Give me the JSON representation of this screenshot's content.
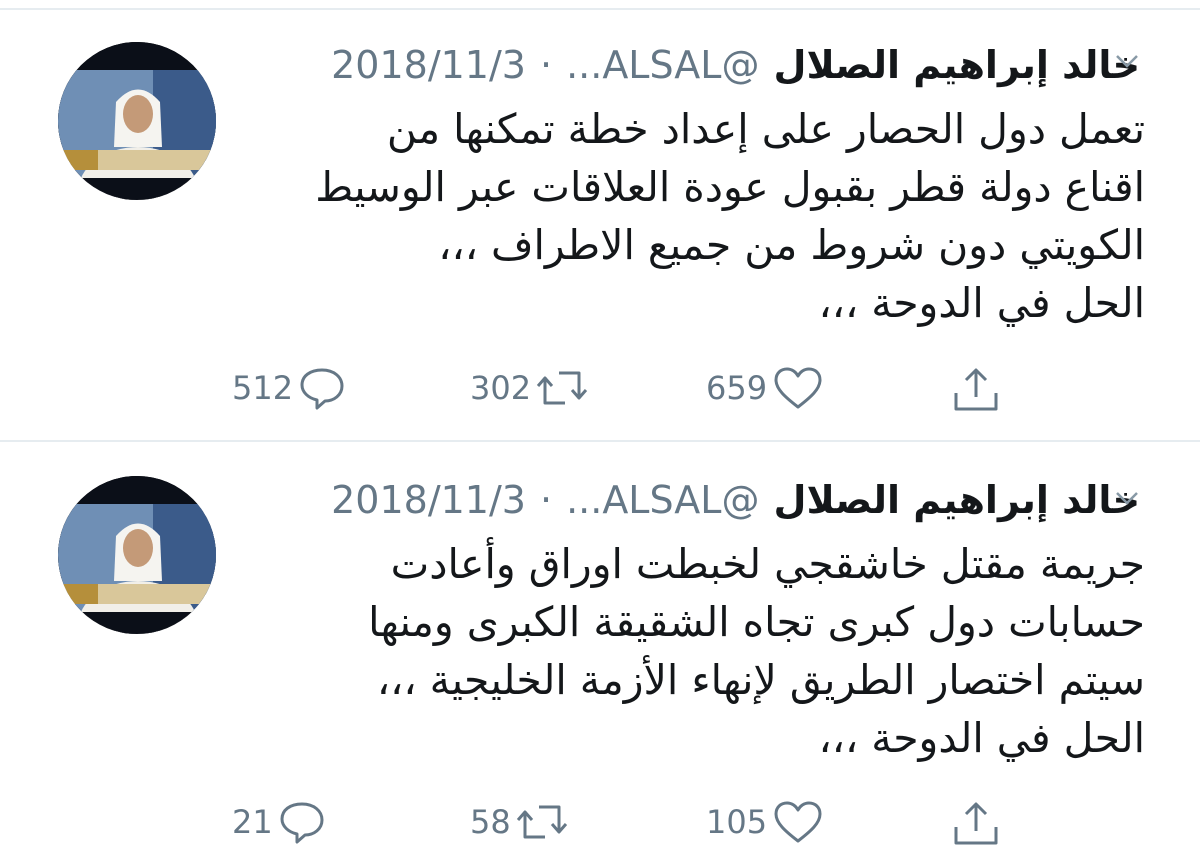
{
  "tweets": [
    {
      "name": "خالد إبراهيم الصلال",
      "handle": "@ALSAL...",
      "separator": "·",
      "date": "2018/11/3",
      "lines": [
        "تعمل دول الحصار على إعداد خطة تمكنها من",
        "اقناع دولة قطر بقبول عودة العلاقات عبر الوسيط",
        "الكويتي دون شروط من جميع الاطراف ،،،",
        "الحل في الدوحة ،،،"
      ],
      "replies": "512",
      "retweets": "302",
      "likes": "659"
    },
    {
      "name": "خالد إبراهيم الصلال",
      "handle": "@ALSAL...",
      "separator": "·",
      "date": "2018/11/3",
      "lines": [
        "جريمة مقتل خاشقجي لخبطت اوراق وأعادت",
        "حسابات دول كبرى تجاه الشقيقة الكبرى ومنها",
        "سيتم اختصار الطريق لإنهاء الأزمة الخليجية ،،،",
        "الحل في الدوحة ،،،"
      ],
      "replies": "21",
      "retweets": "58",
      "likes": "105"
    }
  ],
  "colors": {
    "text": "#14171a",
    "muted": "#657786",
    "divider": "#e6ecf0"
  },
  "icons": [
    "reply-icon",
    "retweet-icon",
    "like-icon",
    "share-icon",
    "chevron-down-icon"
  ]
}
